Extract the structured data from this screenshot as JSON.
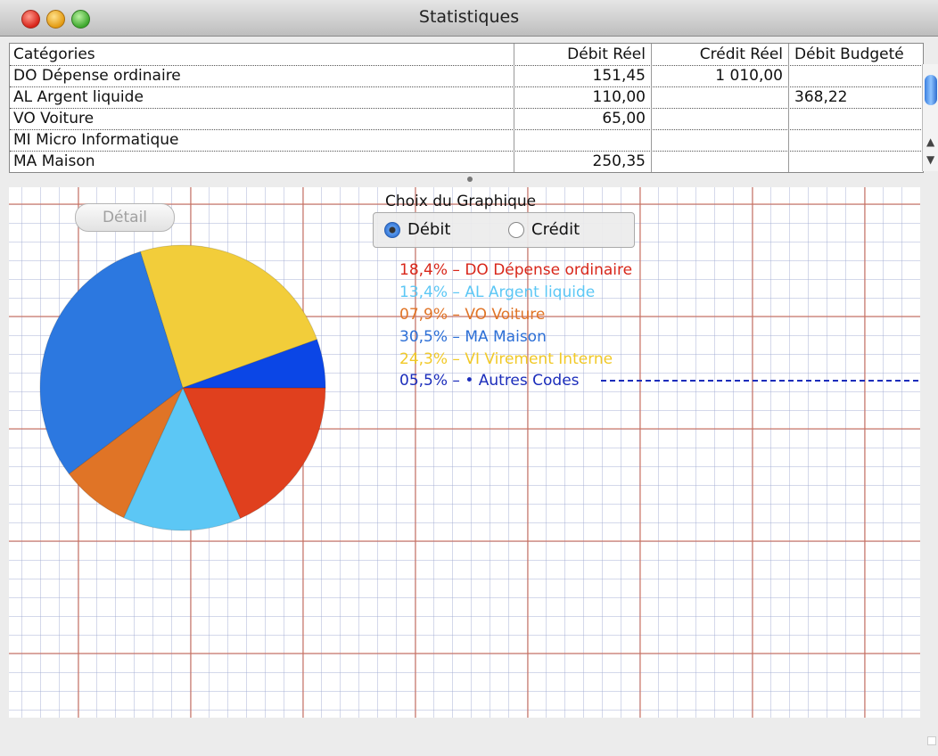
{
  "window": {
    "title": "Statistiques"
  },
  "table": {
    "headers": [
      "Catégories",
      "Débit Réel",
      "Crédit Réel",
      "Débit Budgeté"
    ],
    "rows": [
      [
        "DO Dépense ordinaire",
        "151,45",
        "1 010,00",
        ""
      ],
      [
        "AL Argent liquide",
        "110,00",
        "",
        "368,22"
      ],
      [
        "VO Voiture",
        "65,00",
        "",
        ""
      ],
      [
        "MI Micro Informatique",
        "",
        "",
        ""
      ],
      [
        "MA Maison",
        "250,35",
        "",
        ""
      ]
    ]
  },
  "controls": {
    "detail_label": "Détail",
    "choice_title": "Choix du Graphique",
    "radio_debit": "Débit",
    "radio_credit": "Crédit",
    "selected": "Débit"
  },
  "legend": [
    {
      "text": "18,4% – DO Dépense ordinaire",
      "color": "#d8261a"
    },
    {
      "text": "13,4% – AL Argent liquide",
      "color": "#5cc7f5"
    },
    {
      "text": "07,9% – VO Voiture",
      "color": "#e07426"
    },
    {
      "text": "30,5% – MA Maison",
      "color": "#2c6fd6"
    },
    {
      "text": "24,3% – VI Virement Interne",
      "color": "#f1c927"
    },
    {
      "text": "05,5% – • Autres Codes",
      "color": "#1b2dbb"
    }
  ],
  "chart_data": {
    "type": "pie",
    "categories": [
      "DO Dépense ordinaire",
      "AL Argent liquide",
      "VO Voiture",
      "MA Maison",
      "VI Virement Interne",
      "• Autres Codes"
    ],
    "values": [
      18.4,
      13.4,
      7.9,
      30.5,
      24.3,
      5.5
    ],
    "colors": [
      "#e0401e",
      "#5cc7f5",
      "#e07426",
      "#2c78e0",
      "#f2cd3a",
      "#0b46e6"
    ]
  }
}
